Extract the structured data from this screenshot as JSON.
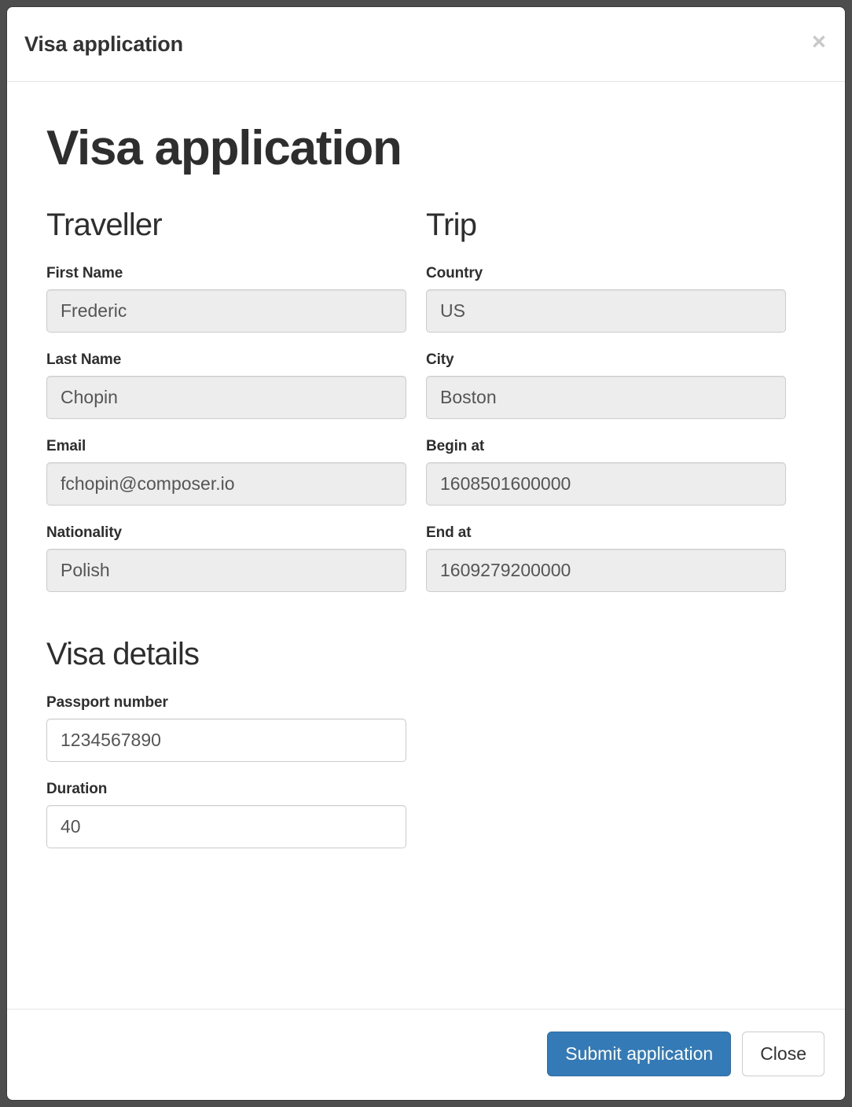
{
  "modal": {
    "header_title": "Visa application",
    "close_icon": "close-icon",
    "close_symbol": "×"
  },
  "page": {
    "title": "Visa application"
  },
  "sections": {
    "traveller": {
      "heading": "Traveller",
      "fields": [
        {
          "label": "First Name",
          "value": "Frederic",
          "disabled": true
        },
        {
          "label": "Last Name",
          "value": "Chopin",
          "disabled": true
        },
        {
          "label": "Email",
          "value": "fchopin@composer.io",
          "disabled": true
        },
        {
          "label": "Nationality",
          "value": "Polish",
          "disabled": true
        }
      ]
    },
    "trip": {
      "heading": "Trip",
      "fields": [
        {
          "label": "Country",
          "value": "US",
          "disabled": true
        },
        {
          "label": "City",
          "value": "Boston",
          "disabled": true
        },
        {
          "label": "Begin at",
          "value": "1608501600000",
          "disabled": true
        },
        {
          "label": "End at",
          "value": "1609279200000",
          "disabled": true
        }
      ]
    },
    "visa_details": {
      "heading": "Visa details",
      "fields": [
        {
          "label": "Passport number",
          "value": "1234567890",
          "disabled": false
        },
        {
          "label": "Duration",
          "value": "40",
          "disabled": false
        }
      ]
    }
  },
  "footer": {
    "submit_label": "Submit application",
    "close_label": "Close"
  },
  "colors": {
    "primary": "#337ab7",
    "primary_border": "#2e6da4",
    "backdrop": "#4d4d4d",
    "disabled_input_bg": "#ededed",
    "input_border": "#cccccc",
    "text": "#2e2e2e"
  }
}
